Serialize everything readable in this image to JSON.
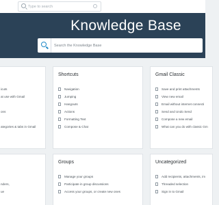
{
  "topbar": {
    "search_placeholder": "Type to search"
  },
  "hero": {
    "title": "Knowledge Base",
    "search_placeholder": "Search the Knowledge Base"
  },
  "cards": [
    {
      "title": "",
      "items": [
        "icuts",
        "at use with Gmail",
        "",
        "ons",
        "",
        "ategories & tabs in Gmail"
      ]
    },
    {
      "title": "Shortcuts",
      "items": [
        "Navigation",
        "Jumping",
        "Hangouts",
        "Actions",
        "Formatting Text",
        "Compose & Chat"
      ]
    },
    {
      "title": "Gmail Classic",
      "items": [
        "Save and print attachments",
        "View new email",
        "Email without internet connecti",
        "Send and Undo Send",
        "Compose a new email",
        "What can you do with classic Gm"
      ]
    },
    {
      "title": "",
      "items": [
        "",
        "nders,",
        "ue"
      ]
    },
    {
      "title": "Groups",
      "items": [
        "Manage your groups",
        "Participate in group discussions",
        "Access your groups, or create new ones"
      ]
    },
    {
      "title": "Uncategorized",
      "items": [
        "Add recipients, attachments, im",
        "Threaded selection",
        "Sign in to Gmail"
      ]
    }
  ]
}
